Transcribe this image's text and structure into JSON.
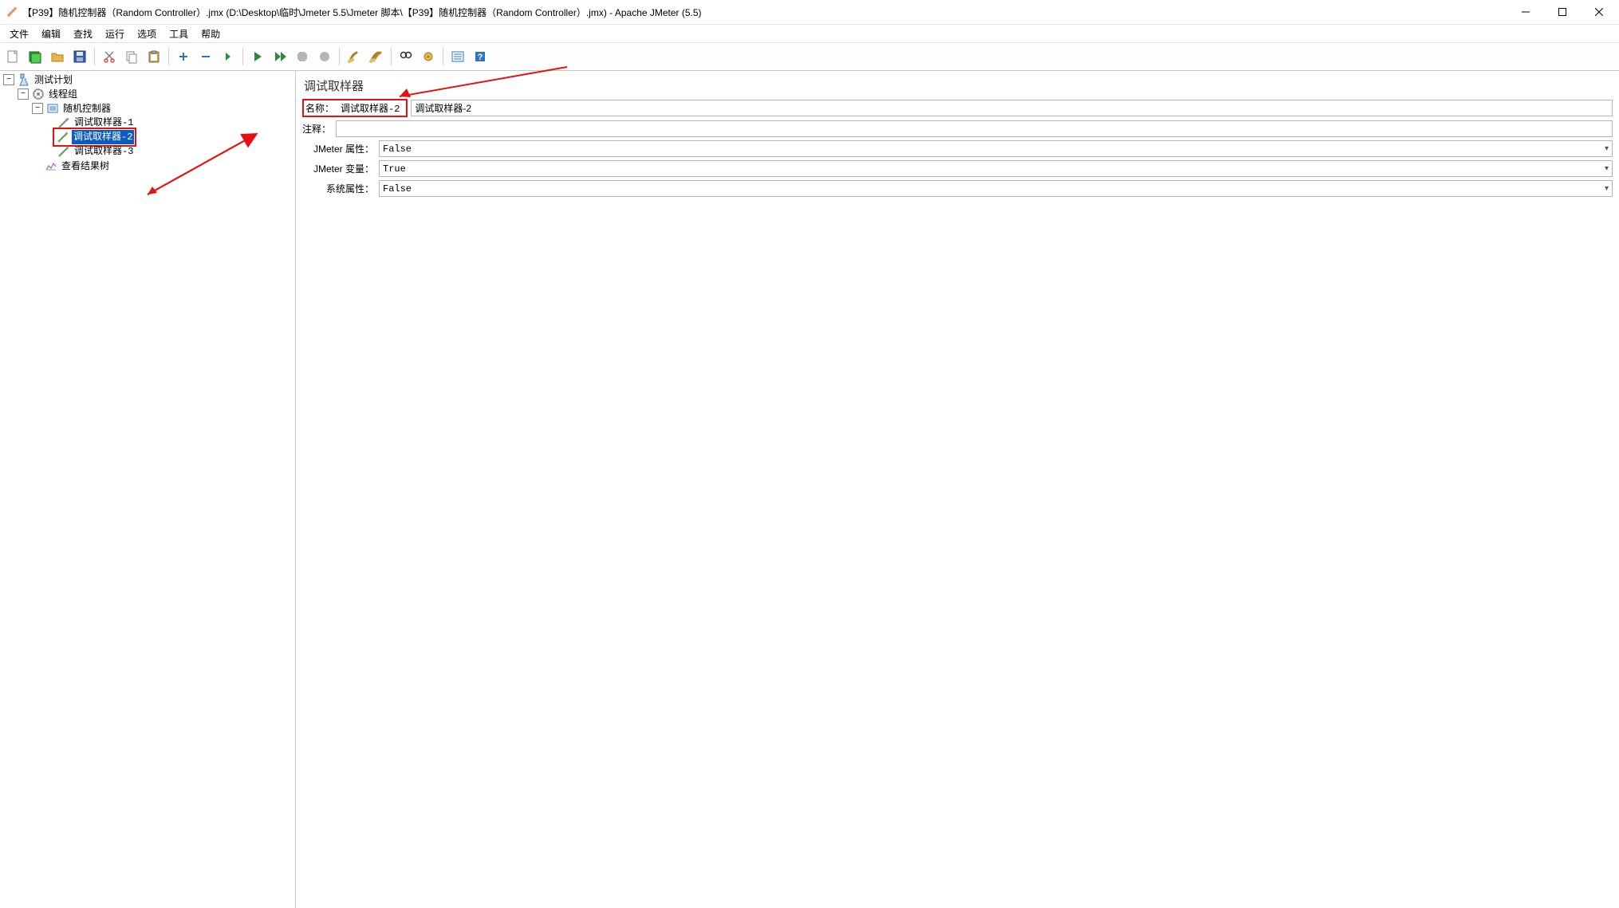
{
  "titlebar": {
    "title": "【P39】随机控制器（Random Controller）.jmx (D:\\Desktop\\临时\\Jmeter 5.5\\Jmeter 脚本\\【P39】随机控制器（Random Controller）.jmx) - Apache JMeter (5.5)"
  },
  "menu": {
    "file": "文件",
    "edit": "编辑",
    "find": "查找",
    "run": "运行",
    "options": "选项",
    "tools": "工具",
    "help": "帮助"
  },
  "toolbar": {
    "new": "新建",
    "open_templates": "模板",
    "open": "打开",
    "save": "保存",
    "cut": "剪切",
    "copy": "复制",
    "paste": "粘贴",
    "expand": "展开",
    "collapse": "折叠",
    "toggle": "切换",
    "start": "开始",
    "start_no_timers": "无停顿开始",
    "stop": "停止",
    "shutdown": "关闭",
    "clear": "清除",
    "clear_all": "清除全部",
    "search": "查找",
    "reset_search": "重置查找",
    "function_helper": "函数助手",
    "help": "帮助"
  },
  "tree": {
    "test_plan": "测试计划",
    "thread_group": "线程组",
    "random_ctrl": "随机控制器",
    "sampler1": "调试取样器-1",
    "sampler2": "调试取样器-2",
    "sampler3": "调试取样器-3",
    "view_results": "查看结果树"
  },
  "panel": {
    "title": "调试取样器",
    "name_label": "名称：",
    "name_value": "调试取样器-2",
    "comment_label": "注释：",
    "comment_value": "",
    "jmeter_props_label": "JMeter 属性：",
    "jmeter_props_value": "False",
    "jmeter_vars_label": "JMeter 变量：",
    "jmeter_vars_value": "True",
    "system_props_label": "系统属性：",
    "system_props_value": "False"
  }
}
